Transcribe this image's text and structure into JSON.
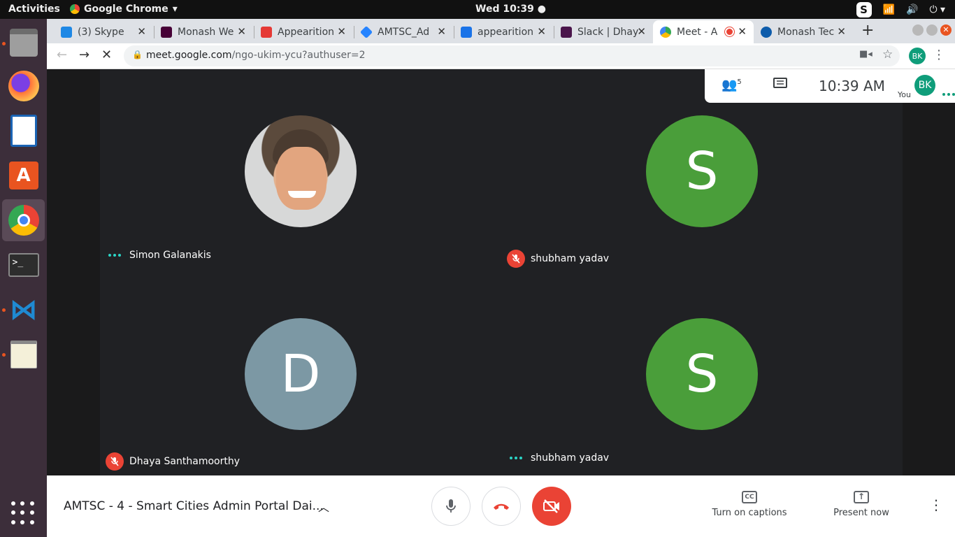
{
  "topbar": {
    "activities": "Activities",
    "app_name": "Google Chrome",
    "clock": "Wed 10:39 ●",
    "tray_skype": "S"
  },
  "tabs": [
    {
      "title": "(3) Skype",
      "favicon_color": "#1e88e5"
    },
    {
      "title": "Monash We",
      "favicon_color": "#470137"
    },
    {
      "title": "Appearition",
      "favicon_color": "#e53935"
    },
    {
      "title": "AMTSC_Ad",
      "favicon_color": "#2684ff"
    },
    {
      "title": "appearition",
      "favicon_color": "#1a73e8"
    },
    {
      "title": "Slack | Dhay",
      "favicon_color": "#4a154b"
    },
    {
      "title": "Meet - A",
      "favicon_color": "#34a853"
    },
    {
      "title": "Monash Tec",
      "favicon_color": "#0d5cab"
    }
  ],
  "omnibox": {
    "host": "meet.google.com",
    "path": "/ngo-ukim-ycu?authuser=2",
    "profile_initials": "BK"
  },
  "meet": {
    "participant_count": "5",
    "time": "10:39  AM",
    "you_label": "You",
    "you_initials": "BK",
    "participants": [
      {
        "name": "Simon Galanakis",
        "initial": "",
        "color": "#d7d8d8",
        "muted": false
      },
      {
        "name": "shubham yadav",
        "initial": "S",
        "color": "#4a9e3a",
        "muted": true
      },
      {
        "name": "Dhaya Santhamoorthy",
        "initial": "D",
        "color": "#7c98a4",
        "muted": true
      },
      {
        "name": "shubham yadav",
        "initial": "S",
        "color": "#4a9e3a",
        "muted": false
      }
    ]
  },
  "bottombar": {
    "meeting_title": "AMTSC - 4 - Smart Cities Admin Portal Dai...",
    "captions_label": "Turn on captions",
    "captions_icon": "CC",
    "present_label": "Present now"
  }
}
